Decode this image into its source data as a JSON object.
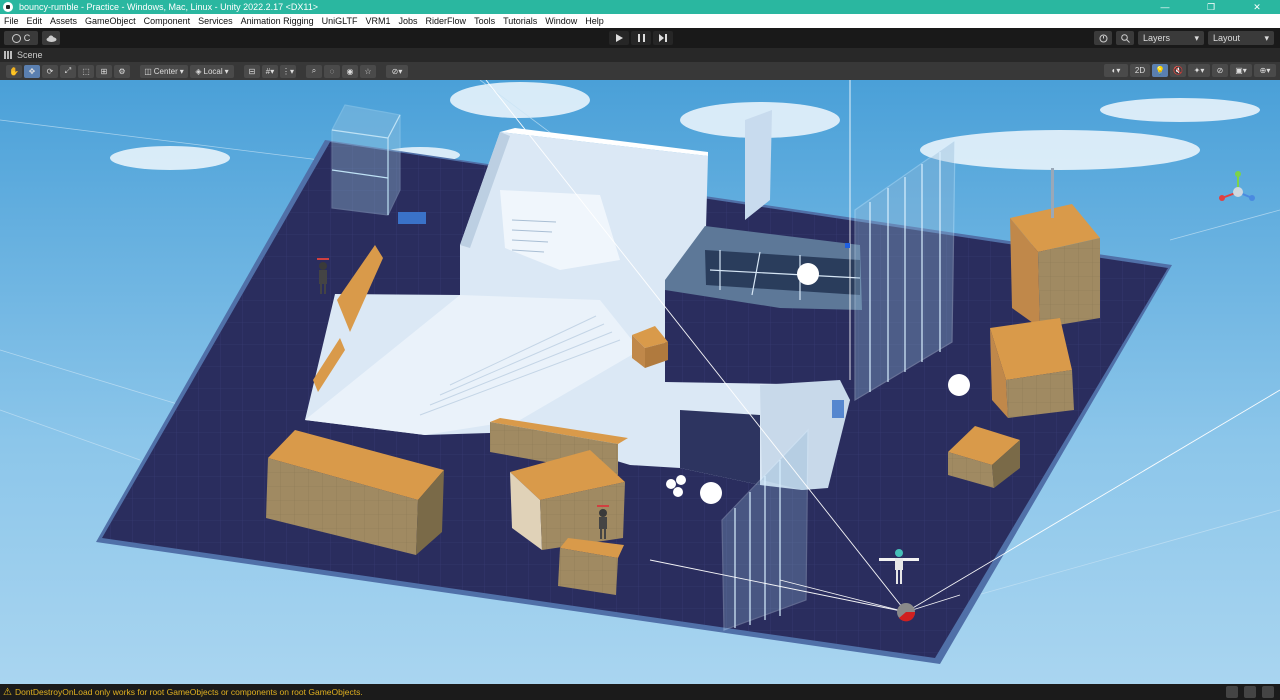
{
  "window": {
    "title": "bouncy-rumble - Practice - Windows, Mac, Linux - Unity 2022.2.17 <DX11>",
    "controls": [
      "—",
      "❐",
      "✕"
    ]
  },
  "menu": [
    "File",
    "Edit",
    "Assets",
    "GameObject",
    "Component",
    "Services",
    "Animation Rigging",
    "UniGLTF",
    "VRM1",
    "Jobs",
    "RiderFlow",
    "Tools",
    "Tutorials",
    "Window",
    "Help"
  ],
  "toolbar": {
    "account_label": "C",
    "layers_label": "Layers",
    "layout_label": "Layout"
  },
  "scene_tab": {
    "label": "Scene"
  },
  "scene_toolbar": {
    "pivot_label": "Center",
    "space_label": "Local",
    "mode_2d_label": "2D"
  },
  "status": {
    "message": "DontDestroyOnLoad only works for root GameObjects or components on root GameObjects."
  },
  "colors": {
    "titlebar": "#2ab7a0",
    "sky_top": "#4aa0d8",
    "floor": "#2a2d5e",
    "crate": "#d99a4a",
    "wall": "#dbe8f5",
    "warning": "#e0b020"
  }
}
